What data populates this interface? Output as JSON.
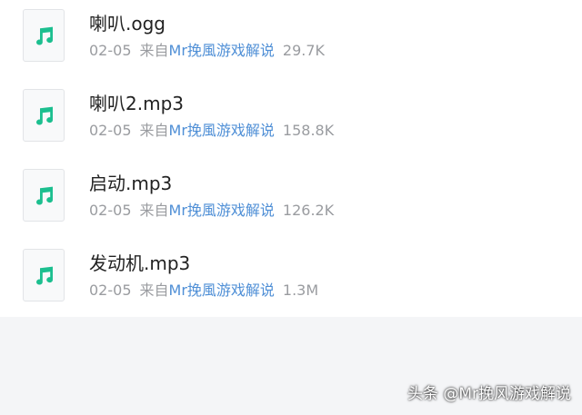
{
  "colors": {
    "accent_icon": "#1cbf8f",
    "channel_link": "#4f8fd6",
    "meta_text": "#9a9ca0",
    "name_text": "#222222",
    "list_background": "#ffffff",
    "page_background": "#f4f5f7"
  },
  "files": [
    {
      "icon": "music-note-icon",
      "name": "喇叭.ogg",
      "date": "02-05",
      "source_prefix": "来自",
      "channel": "Mr挽風游戏解说",
      "size": "29.7K"
    },
    {
      "icon": "music-note-icon",
      "name": "喇叭2.mp3",
      "date": "02-05",
      "source_prefix": "来自",
      "channel": "Mr挽風游戏解说",
      "size": "158.8K"
    },
    {
      "icon": "music-note-icon",
      "name": "启动.mp3",
      "date": "02-05",
      "source_prefix": "来自",
      "channel": "Mr挽風游戏解说",
      "size": "126.2K"
    },
    {
      "icon": "music-note-icon",
      "name": "发动机.mp3",
      "date": "02-05",
      "source_prefix": "来自",
      "channel": "Mr挽風游戏解说",
      "size": "1.3M"
    }
  ],
  "watermark": "头条 @Mr挽风游戏解说"
}
